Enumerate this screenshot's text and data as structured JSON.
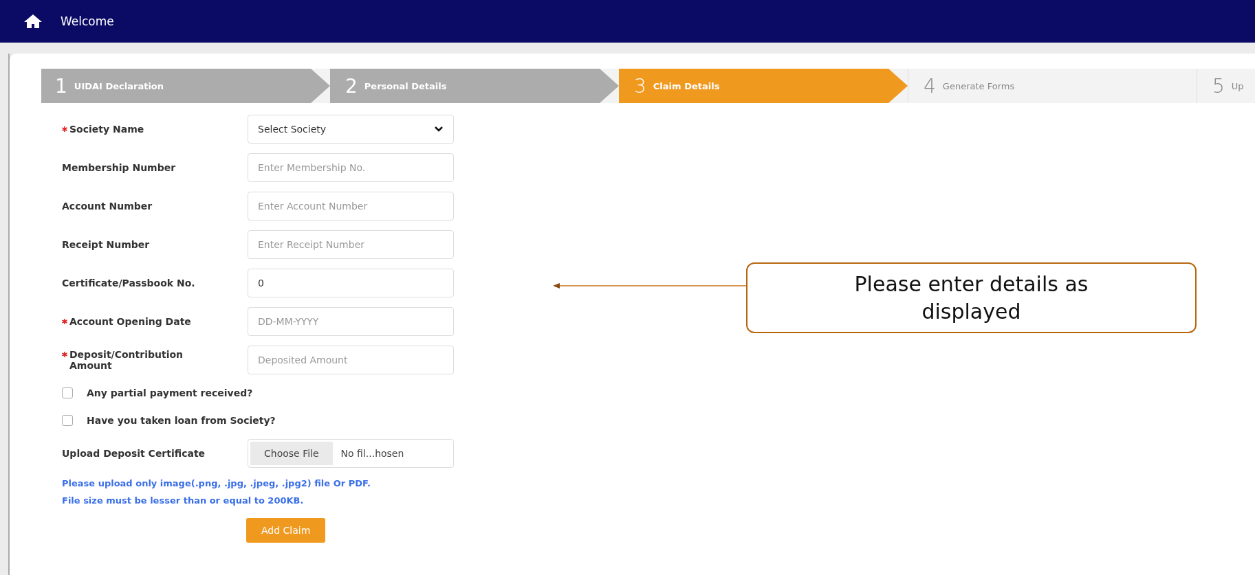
{
  "header": {
    "title": "Welcome"
  },
  "steps": [
    {
      "number": "1",
      "label": "UIDAI Declaration",
      "completed": true,
      "selected": false
    },
    {
      "number": "2",
      "label": "Personal Details",
      "completed": true,
      "selected": false
    },
    {
      "number": "3",
      "label": "Claim Details",
      "completed": false,
      "selected": true
    },
    {
      "number": "4",
      "label": "Generate Forms",
      "completed": false,
      "selected": false
    },
    {
      "number": "5",
      "label": "Up",
      "completed": false,
      "selected": false
    }
  ],
  "form": {
    "fields": [
      {
        "kind": "select",
        "label": "Society Name",
        "required": true,
        "value": "Select Society"
      },
      {
        "kind": "text",
        "label": "Membership Number",
        "required": false,
        "placeholder": "Enter Membership No."
      },
      {
        "kind": "text",
        "label": "Account Number",
        "required": false,
        "placeholder": "Enter Account Number"
      },
      {
        "kind": "text",
        "label": "Receipt Number",
        "required": false,
        "placeholder": "Enter Receipt Number"
      },
      {
        "kind": "text",
        "label": "Certificate/Passbook No.",
        "required": false,
        "value": "0"
      },
      {
        "kind": "text",
        "label": "Account Opening Date",
        "required": true,
        "placeholder": "DD-MM-YYYY"
      },
      {
        "kind": "text",
        "label": "Deposit/Contribution Amount",
        "required": true,
        "placeholder": "Deposited Amount"
      },
      {
        "kind": "checkbox",
        "label": "Any partial payment received?",
        "checked": false
      },
      {
        "kind": "checkbox",
        "label": "Have you taken loan from Society?",
        "checked": false
      },
      {
        "kind": "file",
        "label": "Upload Deposit Certificate",
        "button": "Choose File",
        "value": "No fil...hosen"
      }
    ],
    "notes": [
      "Please upload only image(.png, .jpg, .jpeg, .jpg2) file Or PDF.",
      "File size must be lesser than or equal to 200KB."
    ],
    "submit": "Add Claim"
  },
  "callout": {
    "text": "Please enter details as displayed"
  }
}
